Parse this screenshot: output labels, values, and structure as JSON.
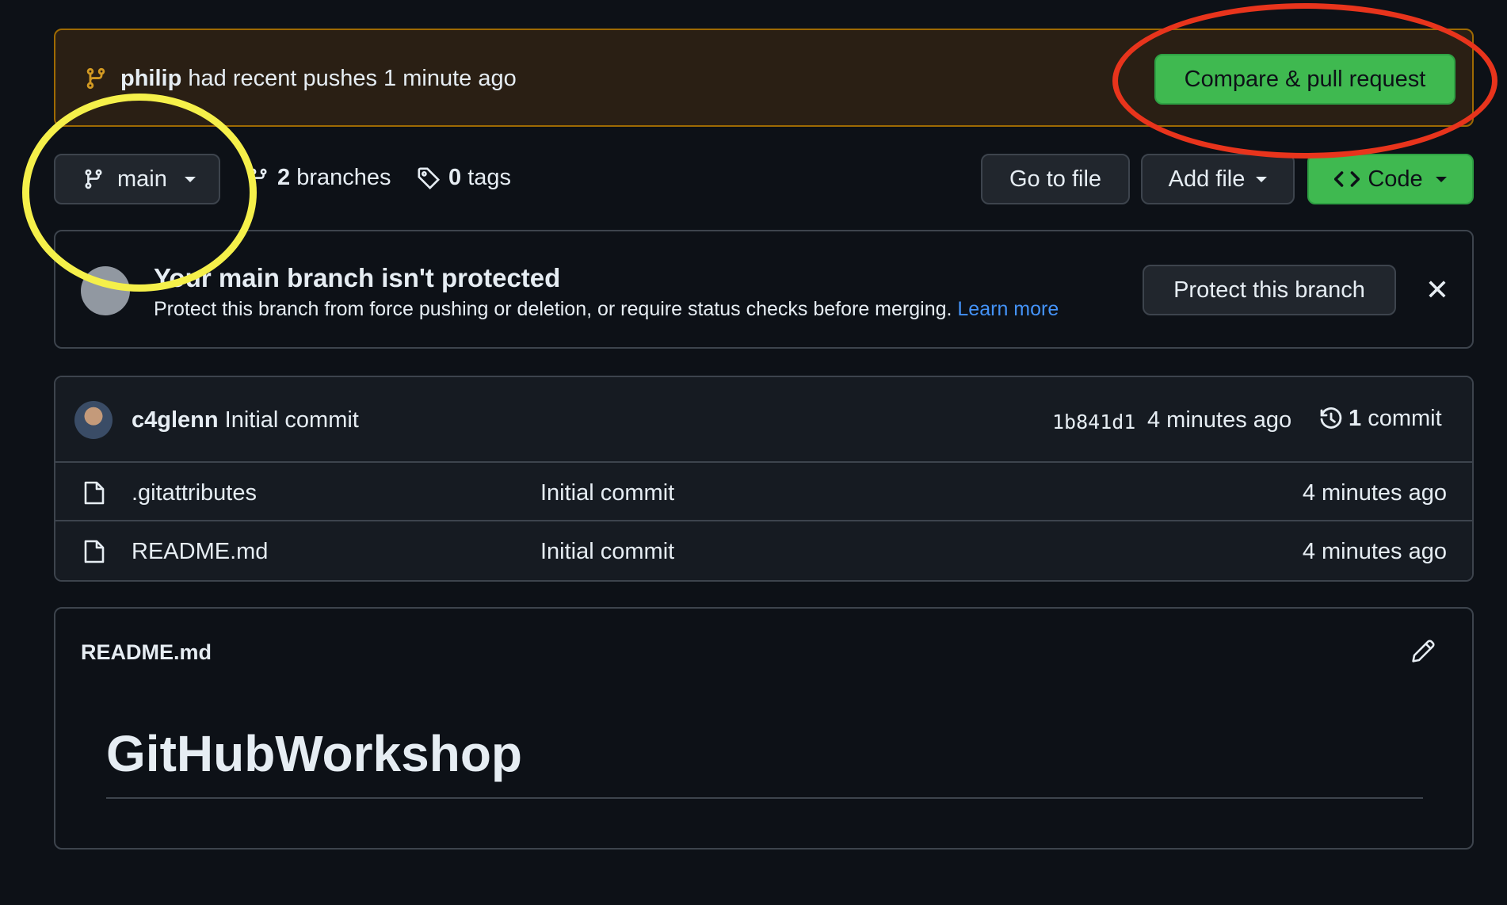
{
  "push_banner": {
    "user": "philip",
    "text": " had recent pushes 1 minute ago",
    "compare_button": "Compare & pull request"
  },
  "toolbar": {
    "branch": "main",
    "branches_count": "2",
    "branches_label": " branches",
    "tags_count": "0",
    "tags_label": " tags",
    "go_to_file": "Go to file",
    "add_file": "Add file",
    "code": "Code"
  },
  "protection": {
    "title": "Your main branch isn't protected",
    "description": "Protect this branch from force pushing or deletion, or require status checks before merging. ",
    "learn_more": "Learn more",
    "protect_button": "Protect this branch",
    "close": "✕"
  },
  "latest_commit": {
    "author": "c4glenn",
    "message": " Initial commit",
    "sha": "1b841d1",
    "age": "4 minutes ago",
    "count": "1",
    "count_label": " commit"
  },
  "files": [
    {
      "name": ".gitattributes",
      "message": "Initial commit",
      "age": "4 minutes ago"
    },
    {
      "name": "README.md",
      "message": "Initial commit",
      "age": "4 minutes ago"
    }
  ],
  "readme": {
    "filename": "README.md",
    "heading": "GitHubWorkshop"
  },
  "colors": {
    "background": "#0d1117",
    "green_button": "#3fb950",
    "link": "#4493f8",
    "annotation_red": "#e8341c",
    "annotation_yellow": "#f5f04a"
  }
}
